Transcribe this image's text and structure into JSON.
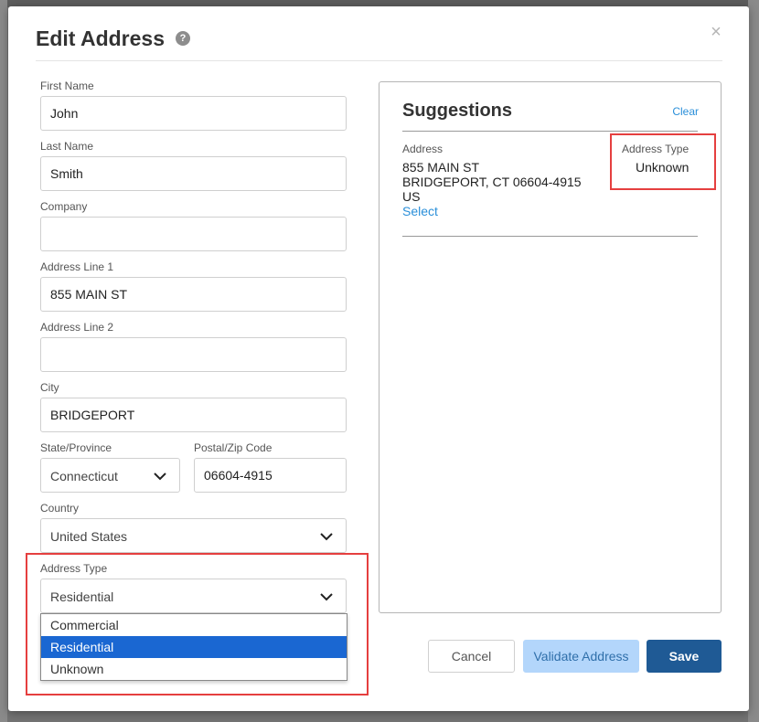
{
  "modal": {
    "title": "Edit Address",
    "help_icon": "question-circle-icon",
    "close_symbol": "×"
  },
  "form": {
    "first_name": {
      "label": "First Name",
      "value": "John"
    },
    "last_name": {
      "label": "Last Name",
      "value": "Smith"
    },
    "company": {
      "label": "Company",
      "value": ""
    },
    "address_line1": {
      "label": "Address Line 1",
      "value": "855 MAIN ST"
    },
    "address_line2": {
      "label": "Address Line 2",
      "value": ""
    },
    "city": {
      "label": "City",
      "value": "BRIDGEPORT"
    },
    "state": {
      "label": "State/Province",
      "value": "Connecticut"
    },
    "postal": {
      "label": "Postal/Zip Code",
      "value": "06604-4915"
    },
    "country": {
      "label": "Country",
      "value": "United States"
    },
    "address_type": {
      "label": "Address Type",
      "value": "Residential",
      "options": [
        "Commercial",
        "Residential",
        "Unknown"
      ]
    }
  },
  "suggestions": {
    "title": "Suggestions",
    "clear_label": "Clear",
    "address_label": "Address",
    "address_lines": [
      "855 MAIN ST",
      "BRIDGEPORT, CT 06604-4915",
      "US"
    ],
    "select_label": "Select",
    "type_label": "Address Type",
    "type_value": "Unknown"
  },
  "buttons": {
    "cancel": "Cancel",
    "validate": "Validate Address",
    "save": "Save"
  },
  "colors": {
    "highlight": "#e53f3f",
    "primary": "#1f5a95",
    "link": "#2a8fd9",
    "selected_option": "#1a67d2"
  }
}
